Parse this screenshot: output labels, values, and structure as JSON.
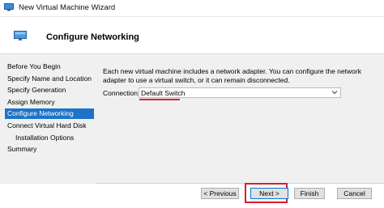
{
  "window": {
    "title": "New Virtual Machine Wizard"
  },
  "header": {
    "title": "Configure Networking"
  },
  "nav": {
    "items": [
      {
        "label": "Before You Begin",
        "sub": false,
        "active": false
      },
      {
        "label": "Specify Name and Location",
        "sub": false,
        "active": false
      },
      {
        "label": "Specify Generation",
        "sub": false,
        "active": false
      },
      {
        "label": "Assign Memory",
        "sub": false,
        "active": false
      },
      {
        "label": "Configure Networking",
        "sub": false,
        "active": true
      },
      {
        "label": "Connect Virtual Hard Disk",
        "sub": false,
        "active": false
      },
      {
        "label": "Installation Options",
        "sub": true,
        "active": false
      },
      {
        "label": "Summary",
        "sub": false,
        "active": false
      }
    ]
  },
  "content": {
    "description": "Each new virtual machine includes a network adapter. You can configure the network adapter to use a virtual switch, or it can remain disconnected.",
    "connection_label": "Connection:",
    "connection_value": "Default Switch"
  },
  "buttons": {
    "previous": "< Previous",
    "next": "Next >",
    "finish": "Finish",
    "cancel": "Cancel"
  },
  "colors": {
    "accent": "#1e73c8",
    "highlight": "#d81e2e"
  },
  "icons": {
    "window": "vm-icon",
    "header": "monitor-icon",
    "dropdown": "chevron-down-icon"
  }
}
